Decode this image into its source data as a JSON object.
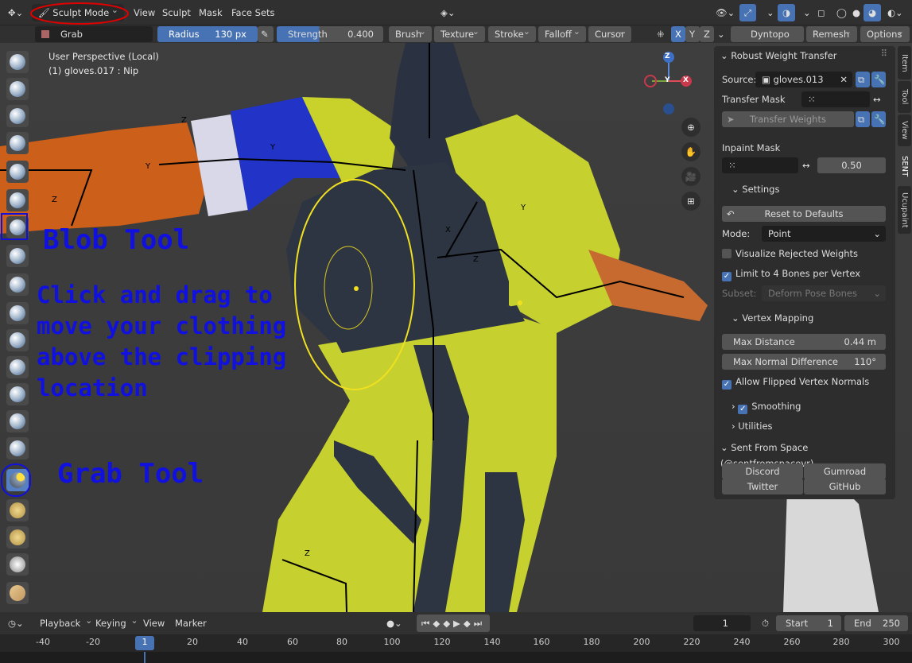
{
  "header": {
    "mode_label": "Sculpt Mode",
    "menus": [
      "View",
      "Sculpt",
      "Mask",
      "Face Sets"
    ],
    "right_buttons": [
      "Dyntopo",
      "Remesh",
      "Options"
    ]
  },
  "tool_header": {
    "brush_name": "Grab",
    "radius_label": "Radius",
    "radius_value": "130 px",
    "strength_label": "Strength",
    "strength_value": "0.400",
    "dropdowns": [
      "Brush",
      "Texture",
      "Stroke",
      "Falloff",
      "Cursor"
    ],
    "axes": [
      "X",
      "Y",
      "Z"
    ]
  },
  "viewport": {
    "view_label": "User Perspective (Local)",
    "object_label": "(1) gloves.017 : Nip",
    "gizmo_axes": {
      "z": "Z",
      "x": "X",
      "y": "Y"
    }
  },
  "annotations": {
    "blob_tool": "Blob Tool",
    "instructions": [
      "Click and drag to",
      "move your clothing",
      "above the clipping",
      "location"
    ],
    "grab_tool": "Grab Tool"
  },
  "sidebar_tabs": [
    "Item",
    "Tool",
    "View",
    "SENT",
    "Ucupaint"
  ],
  "panel": {
    "title": "Robust Weight Transfer",
    "source_label": "Source:",
    "source_value": "gloves.013",
    "transfer_mask_label": "Transfer Mask",
    "transfer_weights_button": "Transfer Weights",
    "inpaint_mask_label": "Inpaint Mask",
    "inpaint_value": "0.50",
    "settings_label": "Settings",
    "reset_button": "Reset to Defaults",
    "mode_label": "Mode:",
    "mode_value": "Point",
    "visualize_label": "Visualize Rejected Weights",
    "visualize_checked": false,
    "limit_label": "Limit to 4 Bones per Vertex",
    "limit_checked": true,
    "subset_label": "Subset:",
    "subset_value": "Deform Pose Bones",
    "vertex_mapping_label": "Vertex Mapping",
    "max_distance_label": "Max Distance",
    "max_distance_value": "0.44 m",
    "max_normal_label": "Max Normal Difference",
    "max_normal_value": "110°",
    "allow_flipped_label": "Allow Flipped Vertex Normals",
    "allow_flipped_checked": true,
    "smoothing_label": "Smoothing",
    "smoothing_checked": true,
    "utilities_label": "Utilities",
    "sent_label": "Sent From Space (@sentfromspacevr)",
    "links": [
      "Discord",
      "Gumroad",
      "Twitter",
      "GitHub"
    ]
  },
  "timeline": {
    "menus": [
      "Playback",
      "Keying",
      "View",
      "Marker"
    ],
    "current_frame": "1",
    "start_label": "Start",
    "start_value": "1",
    "end_label": "End",
    "end_value": "250",
    "ruler_ticks": [
      "-40",
      "-20",
      "1",
      "20",
      "40",
      "60",
      "80",
      "100",
      "120",
      "140",
      "160",
      "180",
      "200",
      "220",
      "240",
      "260",
      "280",
      "300"
    ]
  },
  "colors": {
    "accent": "#4772b3",
    "annotation": "#1010e0",
    "brush_cursor": "#f0e020",
    "highlight_circle_red": "#e00000"
  }
}
